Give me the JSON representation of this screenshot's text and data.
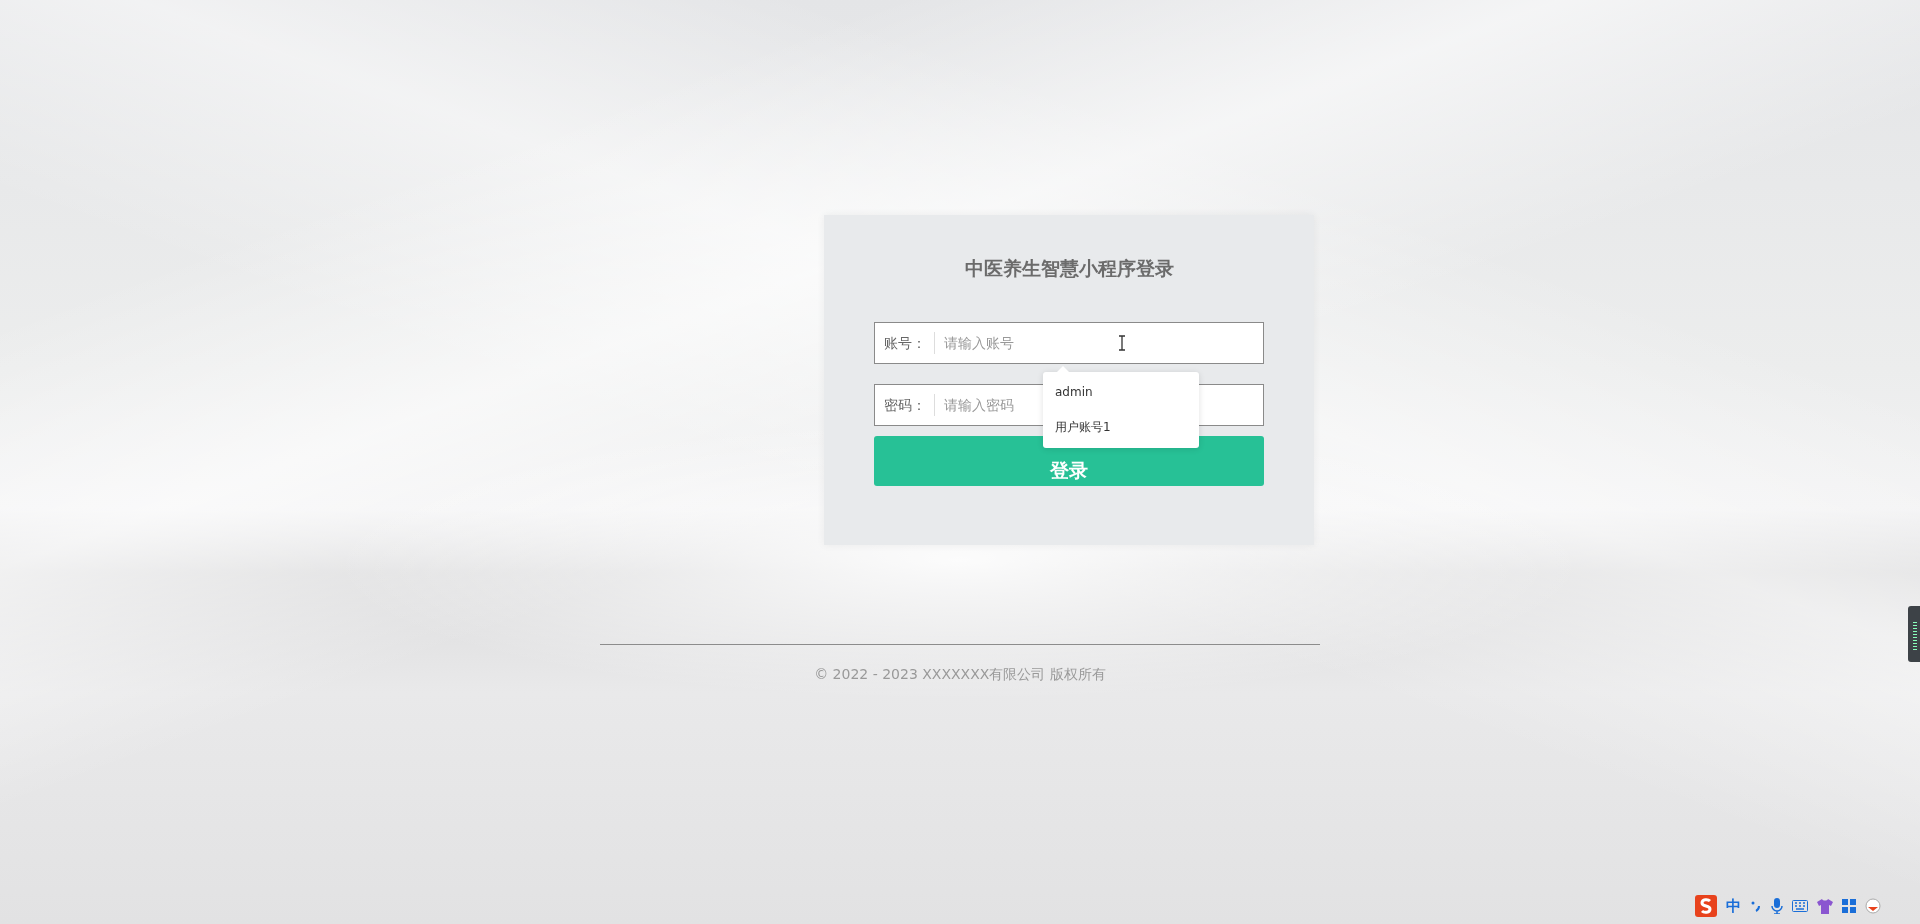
{
  "login_card": {
    "title": "中医养生智慧小程序登录",
    "fields": [
      {
        "label": "账号：",
        "placeholder": "请输入账号"
      },
      {
        "label": "密码：",
        "placeholder": "请输入密码"
      }
    ],
    "submit": "登录"
  },
  "autocomplete": {
    "items": [
      "admin",
      "用户账号1"
    ]
  },
  "footer": {
    "copyright": "© 2022 - 2023 XXXXXXX有限公司 版权所有"
  },
  "ime_toolbar": {
    "mode": "中"
  }
}
